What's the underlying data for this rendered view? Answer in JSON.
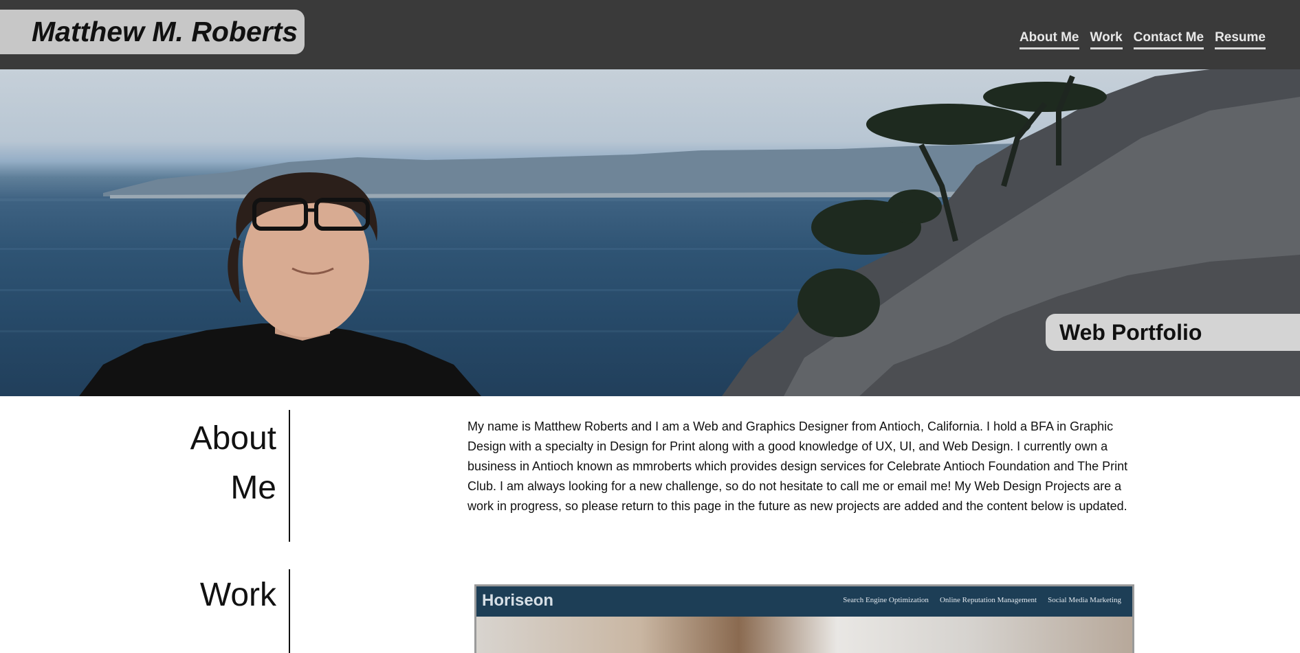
{
  "header": {
    "site_title": "Matthew M. Roberts",
    "nav": [
      {
        "label": "About Me"
      },
      {
        "label": "Work"
      },
      {
        "label": "Contact Me"
      },
      {
        "label": "Resume"
      }
    ]
  },
  "hero": {
    "tag": "Web Portfolio"
  },
  "about": {
    "heading_line1": "About",
    "heading_line2": "Me",
    "body": "My name is Matthew Roberts and I am a Web and Graphics Designer from Antioch, California. I hold a BFA in Graphic Design with a specialty in Design for Print along with a good knowledge of UX, UI, and Web Design. I currently own a business in Antioch known as mmroberts which provides design services for Celebrate Antioch Foundation and The Print Club. I am always looking for a new challenge, so do not hesitate to call me or email me! My Web Design Projects are a work in progress, so please return to this page in the future as new projects are added and the content below is updated."
  },
  "work": {
    "heading": "Work",
    "projects": [
      {
        "logo": "Horiseon",
        "nav": [
          "Search Engine Optimization",
          "Online Reputation Management",
          "Social Media Marketing"
        ]
      }
    ]
  },
  "colors": {
    "header_bg": "#3a3a3a",
    "title_badge_bg": "#c7c7c7",
    "nav_text": "#e8e8e8",
    "portfolio_tab_bg": "#d4d4d4",
    "project_header_bg": "#1d3e56"
  }
}
